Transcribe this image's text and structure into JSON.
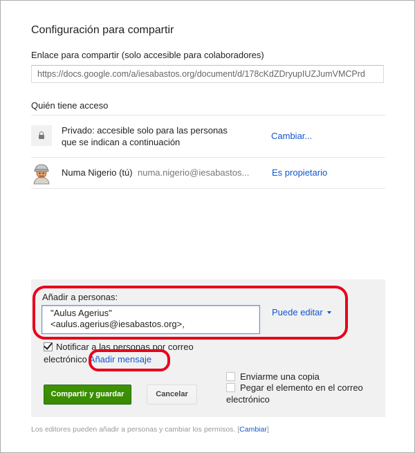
{
  "dialog": {
    "title": "Configuración para compartir",
    "link_label": "Enlace para compartir (solo accesible para colaboradores)",
    "share_url": "https://docs.google.com/a/iesabastos.org/document/d/178cKdZDryupIUZJumVMCPrd",
    "who_has_access": "Quién tiene acceso"
  },
  "access": {
    "private_line1": "Privado: accesible solo para las personas",
    "private_line2": "que se indican a continuación",
    "change_link": "Cambiar...",
    "owner_name": "Numa Nigerio (tú)",
    "owner_email": "numa.nigerio@iesabastos...",
    "owner_role": "Es propietario"
  },
  "add_people": {
    "label": "Añadir a personas:",
    "entry_line1": "\"Aulus Agerius\"",
    "entry_line2": "<aulus.agerius@iesabastos.org>,",
    "permission": "Puede editar",
    "notify_text_a": "Notificar a las personas por correo",
    "notify_text_b": "electrónico",
    "notify_checked": true,
    "add_message": "Añadir mensaje",
    "send_copy": "Enviarme una copia",
    "send_copy_checked": false,
    "paste_line1": "Pegar el elemento en el correo",
    "paste_line2": "electrónico",
    "paste_checked": false,
    "share_save_button": "Compartir y guardar",
    "cancel_button": "Cancelar"
  },
  "footer": {
    "text": "Los editores pueden añadir a personas y cambiar los permisos.",
    "bracket_open": "[",
    "change_link": "Cambiar",
    "bracket_close": "]"
  },
  "colors": {
    "link_blue": "#1155cc",
    "primary_green": "#3d9400",
    "annotation_red": "#e8001c",
    "panel_gray": "#f1f1f1"
  }
}
